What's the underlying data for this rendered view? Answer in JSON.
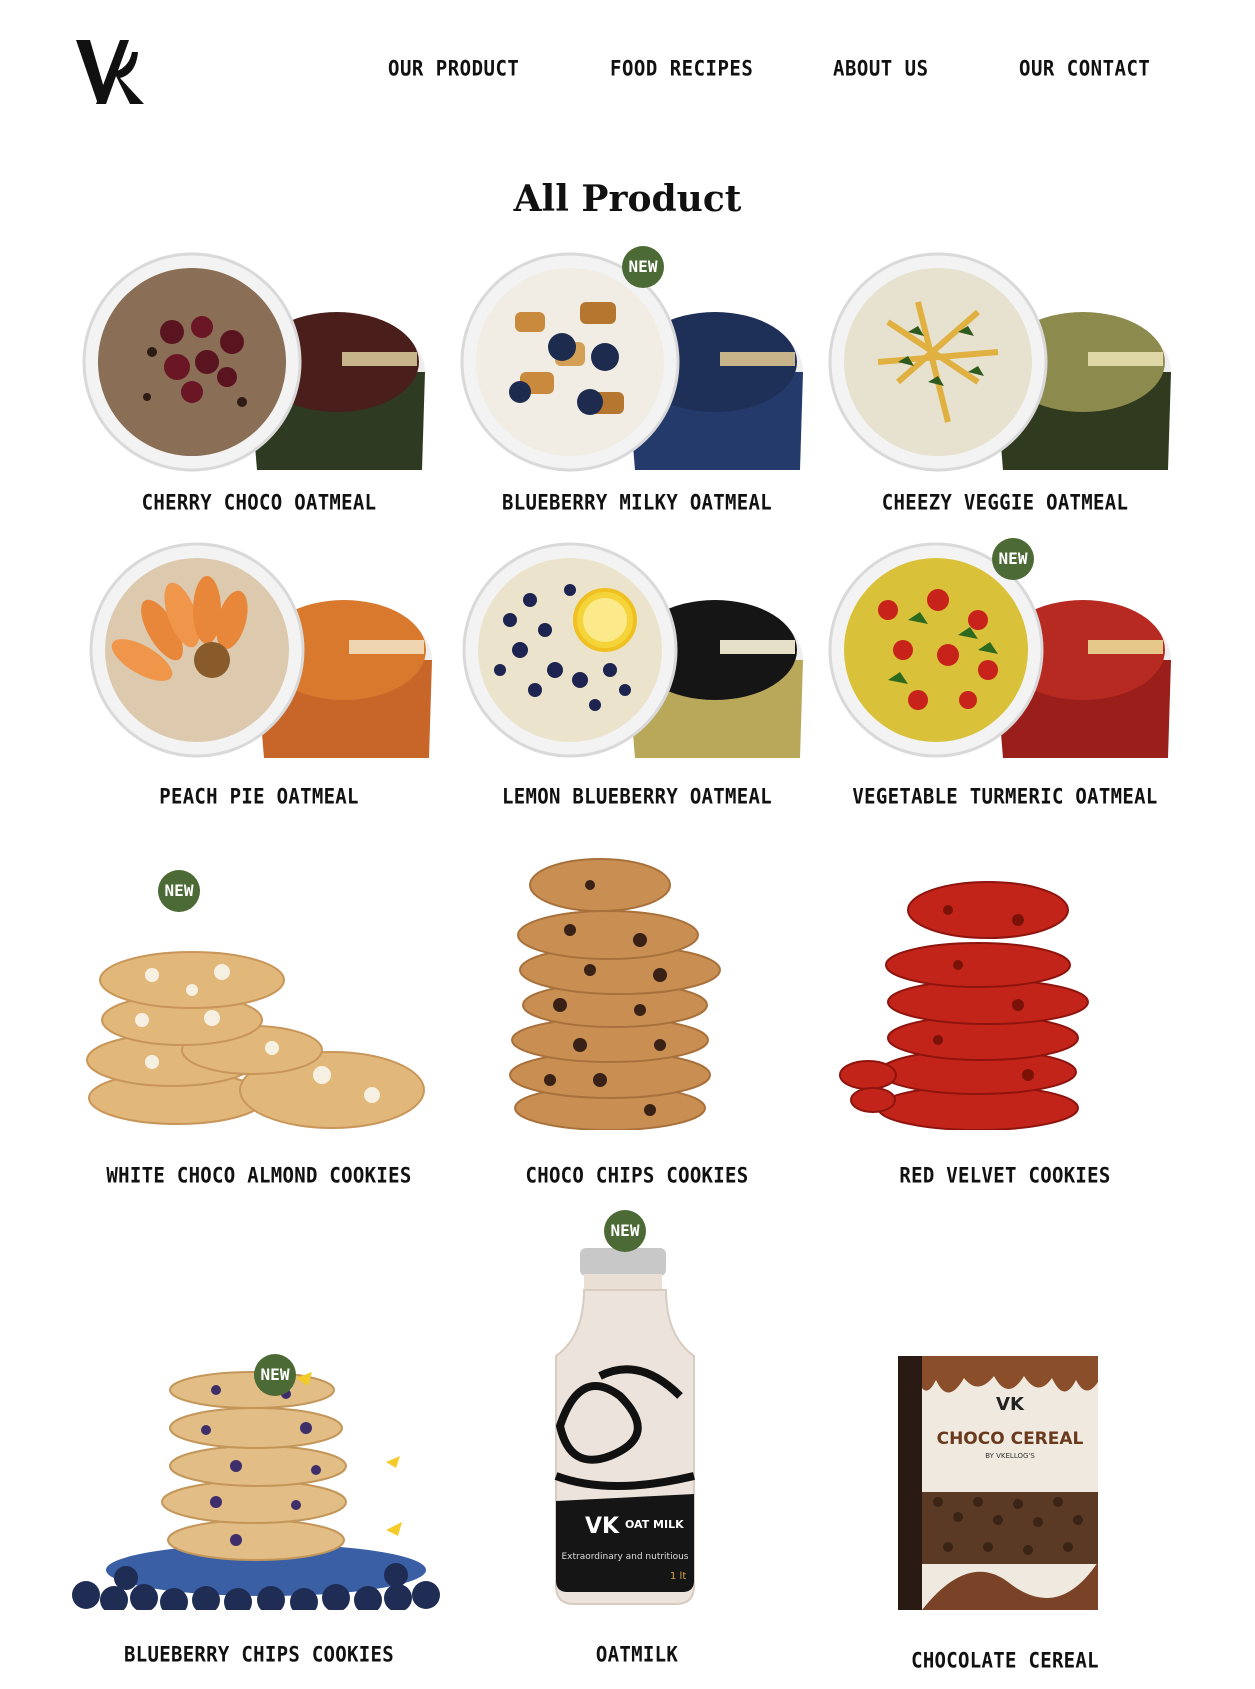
{
  "brand": {
    "logo": "VK"
  },
  "nav": {
    "items": [
      {
        "label": "OUR PRODUCT"
      },
      {
        "label": "FOOD RECIPES"
      },
      {
        "label": "ABOUT US"
      },
      {
        "label": "OUR CONTACT"
      }
    ]
  },
  "page": {
    "title": "All Product"
  },
  "badge_text": "NEW",
  "colors": {
    "badge": "#4c6a35",
    "text": "#111111",
    "background": "#ffffff"
  },
  "products": [
    {
      "name": "CHERRY CHOCO OATMEAL",
      "is_new": false,
      "image": "oatmeal-cup-cherry-choco"
    },
    {
      "name": "BLUEBERRY MILKY OATMEAL",
      "is_new": true,
      "image": "oatmeal-cup-blueberry-milky"
    },
    {
      "name": "CHEEZY VEGGIE OATMEAL",
      "is_new": false,
      "image": "oatmeal-cup-cheezy-veggie"
    },
    {
      "name": "PEACH PIE OATMEAL",
      "is_new": false,
      "image": "oatmeal-cup-peach-pie"
    },
    {
      "name": "LEMON BLUEBERRY OATMEAL",
      "is_new": false,
      "image": "oatmeal-cup-lemon-blueberry"
    },
    {
      "name": "VEGETABLE TURMERIC OATMEAL",
      "is_new": true,
      "image": "oatmeal-cup-vegetable-turmeric"
    },
    {
      "name": "WHITE CHOCO ALMOND COOKIES",
      "is_new": true,
      "image": "cookie-stack-white-choco"
    },
    {
      "name": "CHOCO CHIPS COOKIES",
      "is_new": false,
      "image": "cookie-stack-choco-chips"
    },
    {
      "name": "RED VELVET COOKIES",
      "is_new": false,
      "image": "cookie-stack-red-velvet"
    },
    {
      "name": "BLUEBERRY CHIPS COOKIES",
      "is_new": true,
      "image": "cookie-stack-blueberry"
    },
    {
      "name": "OATMILK",
      "is_new": true,
      "image": "oatmilk-bottle",
      "package_text": {
        "brand": "OAT MILK",
        "tagline": "Extraordinary and nutritious",
        "volume": "1 lt"
      }
    },
    {
      "name": "CHOCOLATE CEREAL",
      "is_new": false,
      "image": "cereal-box",
      "package_text": {
        "title": "CHOCO CEREAL",
        "subtitle": "BY VKELLOG'S"
      }
    }
  ]
}
